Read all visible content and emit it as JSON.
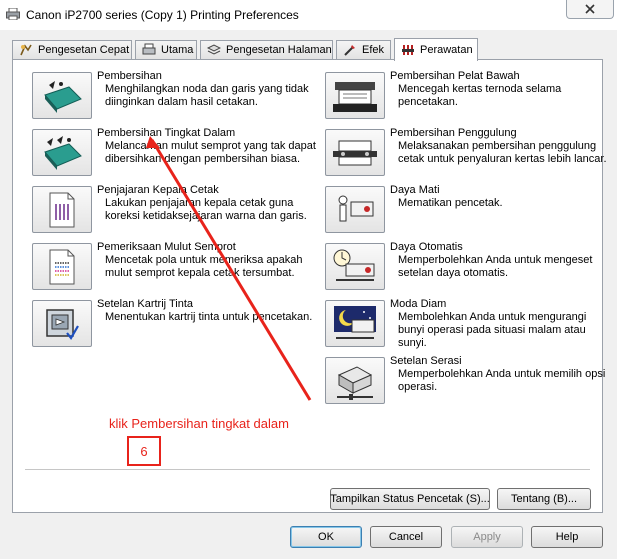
{
  "window": {
    "title": "Canon iP2700 series (Copy 1) Printing Preferences"
  },
  "tabs": [
    {
      "label": "Pengesetan Cepat",
      "icon": "quick-setup-icon"
    },
    {
      "label": "Utama",
      "icon": "main-icon"
    },
    {
      "label": "Pengesetan Halaman",
      "icon": "page-setup-icon"
    },
    {
      "label": "Efek",
      "icon": "effects-icon"
    },
    {
      "label": "Perawatan",
      "icon": "maintenance-icon",
      "active": true
    }
  ],
  "left_items": [
    {
      "name": "Pembersihan",
      "desc": "Menghilangkan noda dan garis yang tidak diinginkan dalam hasil cetakan.",
      "icon": "cleaning-icon"
    },
    {
      "name": "Pembersihan Tingkat Dalam",
      "desc": "Melancarkan mulut semprot yang tak dapat dibersihkan dengan pembersihan biasa.",
      "icon": "deep-cleaning-icon"
    },
    {
      "name": "Penjajaran Kepala Cetak",
      "desc": "Lakukan penjajaran kepala cetak guna koreksi ketidaksejajaran warna dan garis.",
      "icon": "print-head-alignment-icon"
    },
    {
      "name": "Pemeriksaan Mulut Semprot",
      "desc": "Mencetak pola untuk memeriksa apakah mulut semprot kepala cetak tersumbat.",
      "icon": "nozzle-check-icon"
    },
    {
      "name": "Setelan Kartrij Tinta",
      "desc": "Menentukan kartrij tinta untuk pencetakan.",
      "icon": "ink-cartridge-icon"
    }
  ],
  "right_items": [
    {
      "name": "Pembersihan Pelat Bawah",
      "desc": "Mencegah kertas ternoda selama pencetakan.",
      "icon": "bottom-plate-cleaning-icon"
    },
    {
      "name": "Pembersihan Penggulung",
      "desc": "Melaksanakan pembersihan penggulung cetak untuk penyaluran kertas lebih lancar.",
      "icon": "roller-cleaning-icon"
    },
    {
      "name": "Daya Mati",
      "desc": "Mematikan pencetak.",
      "icon": "power-off-icon"
    },
    {
      "name": "Daya Otomatis",
      "desc": "Memperbolehkan Anda untuk mengeset setelan daya otomatis.",
      "icon": "auto-power-icon"
    },
    {
      "name": "Moda Diam",
      "desc": "Membolehkan Anda untuk mengurangi bunyi operasi pada situasi malam atau sunyi.",
      "icon": "quiet-mode-icon"
    },
    {
      "name": "Setelan Serasi",
      "desc": "Memperbolehkan Anda untuk memilih opsi operasi.",
      "icon": "custom-settings-icon"
    }
  ],
  "panel_buttons": {
    "status": "Tampilkan Status Pencetak (S)...",
    "about": "Tentang (B)..."
  },
  "dialog_buttons": {
    "ok": "OK",
    "cancel": "Cancel",
    "apply": "Apply",
    "help": "Help"
  },
  "annotation": {
    "text": "klik Pembersihan tingkat dalam",
    "step": "6",
    "color": "#e8231b"
  }
}
